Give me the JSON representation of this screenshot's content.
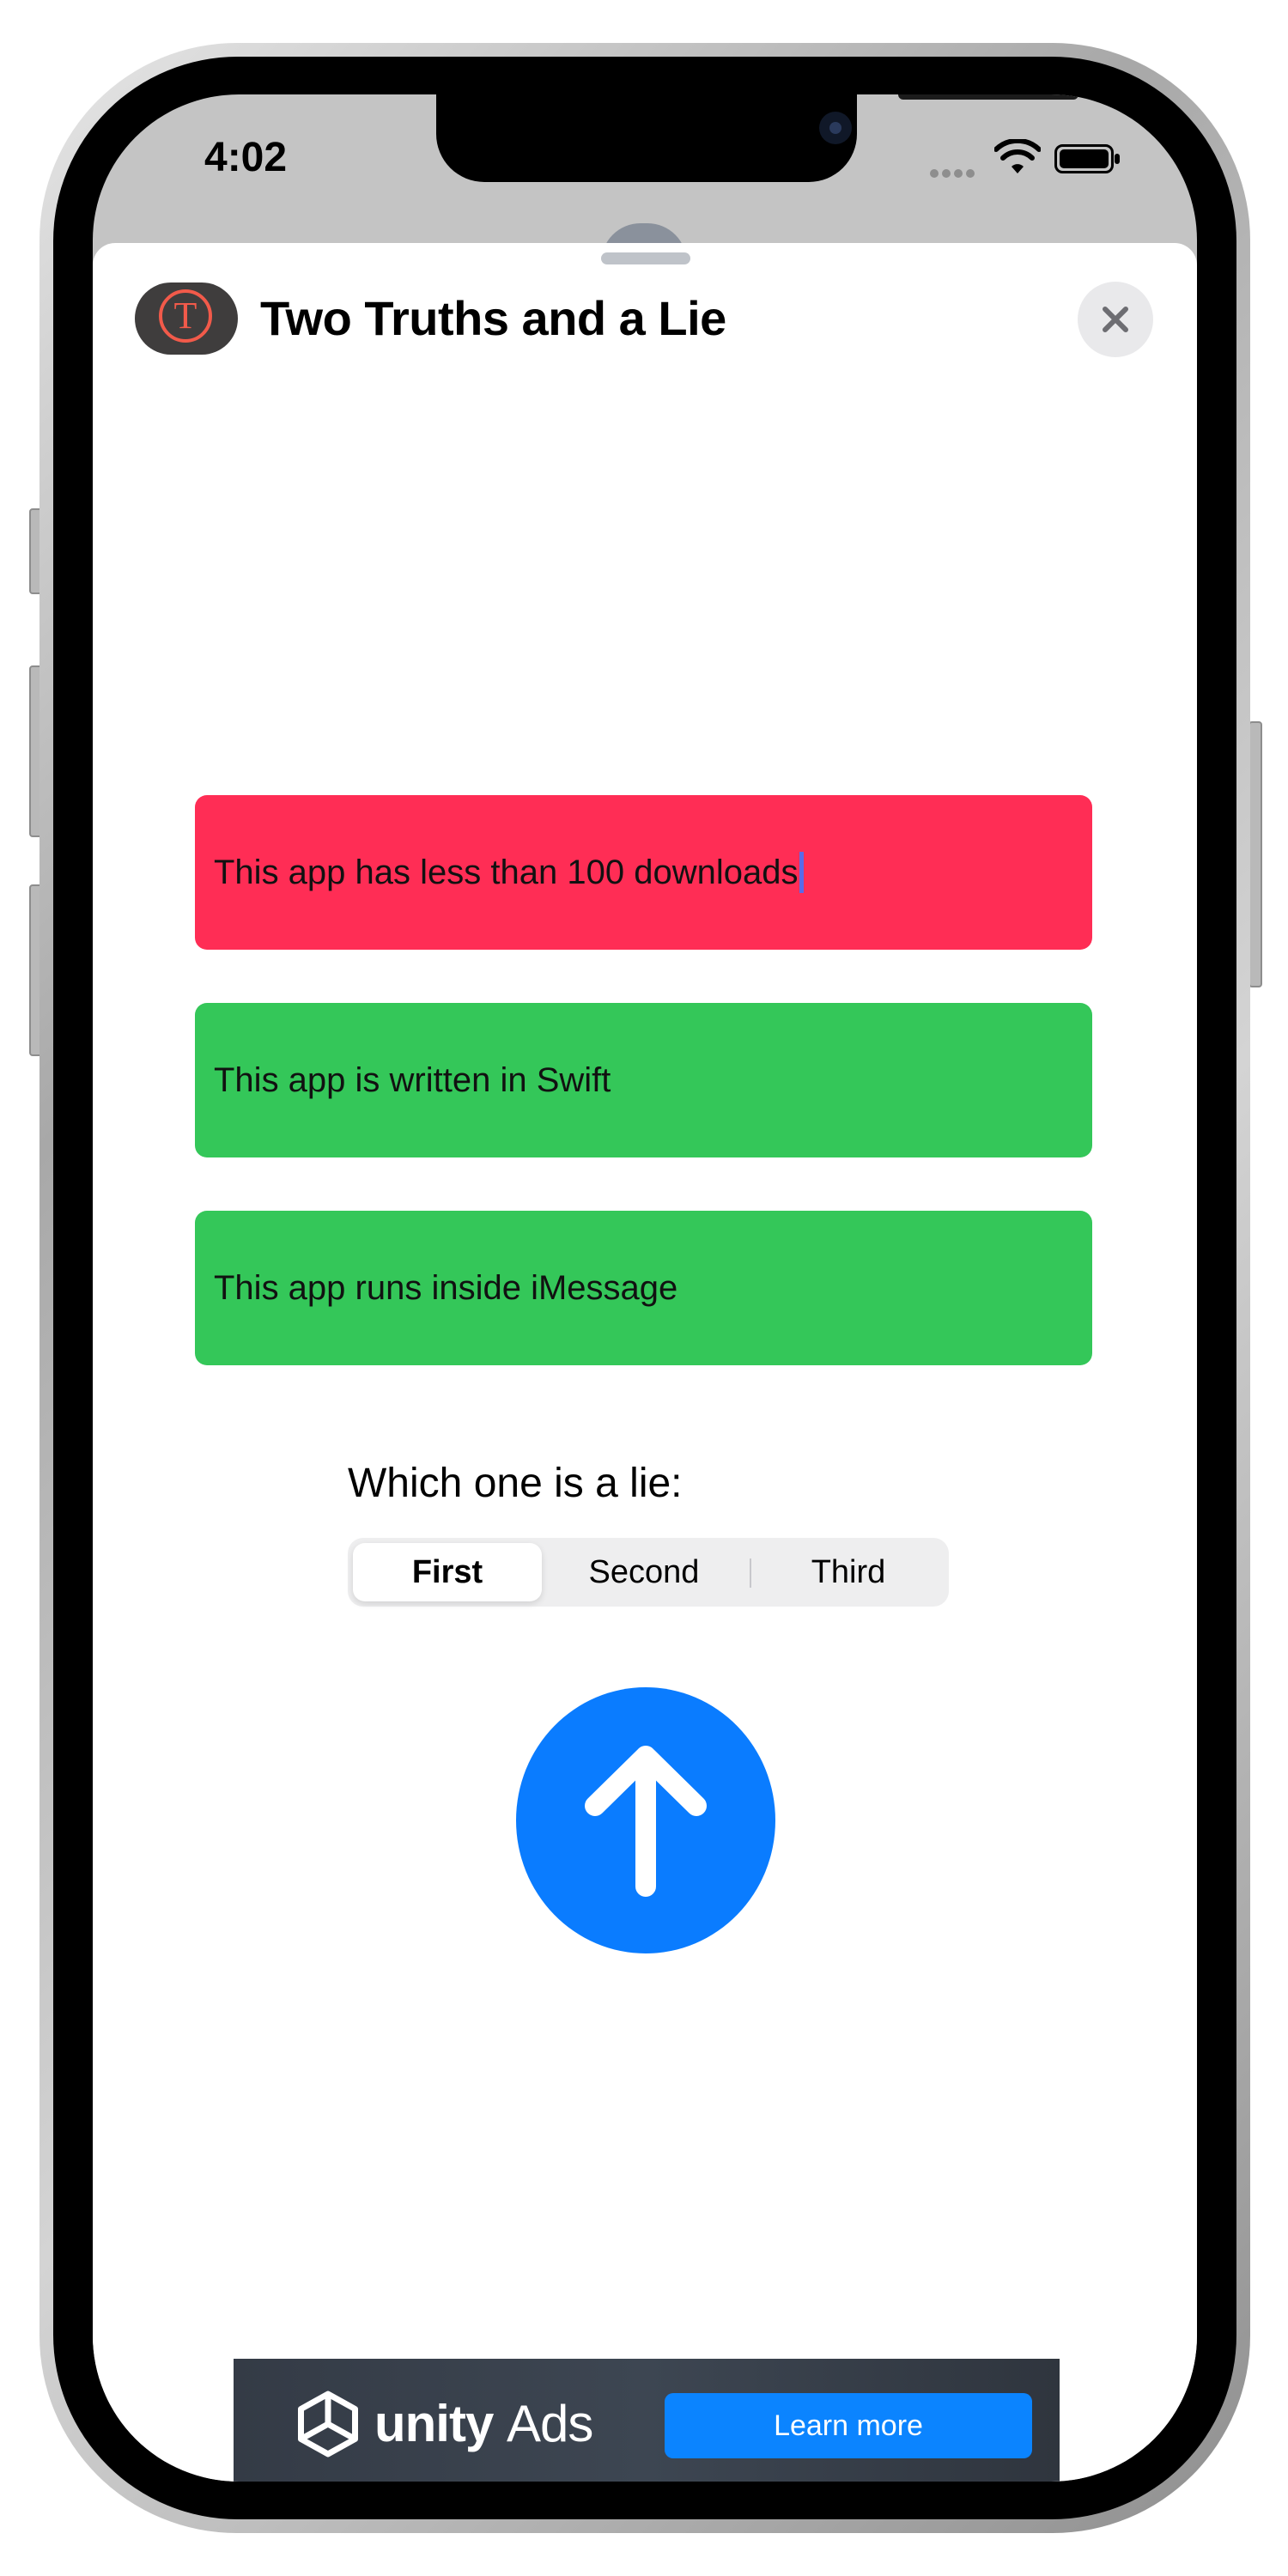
{
  "status_bar": {
    "time": "4:02",
    "icons": [
      "cellular-dots-icon",
      "wifi-icon",
      "battery-icon"
    ]
  },
  "app": {
    "title": "Two Truths and a Lie",
    "icon_letter": "T",
    "icon_name": "app-logo-t-icon",
    "close_icon": "close-icon"
  },
  "statements": [
    {
      "text": "This app has less than 100 downloads",
      "color": "#ff2d55",
      "state": "editing"
    },
    {
      "text": "This app is written in Swift",
      "color": "#34c759",
      "state": "normal"
    },
    {
      "text": "This app runs inside iMessage",
      "color": "#34c759",
      "state": "normal"
    }
  ],
  "question": {
    "label": "Which one is a lie:",
    "options": [
      "First",
      "Second",
      "Third"
    ],
    "selected": "First"
  },
  "submit": {
    "icon": "arrow-up-icon",
    "color": "#0a7cff"
  },
  "ad": {
    "brand": "unity",
    "brand_suffix": "Ads",
    "cta": "Learn more",
    "logo_icon": "unity-logo-icon"
  },
  "colors": {
    "accent": "#0a7cff",
    "lie": "#ff2d55",
    "truth": "#34c759"
  }
}
